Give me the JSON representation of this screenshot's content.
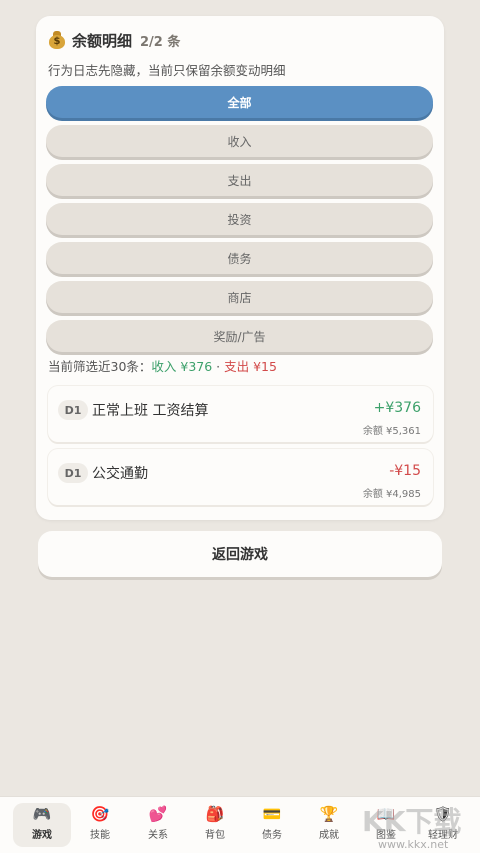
{
  "panel": {
    "icon": "money-bag-icon",
    "title": "余额明细",
    "count": "2/2 条",
    "subtitle": "行为日志先隐藏，当前只保留余额变动明细"
  },
  "filters": [
    {
      "label": "全部",
      "active": true
    },
    {
      "label": "收入",
      "active": false
    },
    {
      "label": "支出",
      "active": false
    },
    {
      "label": "投资",
      "active": false
    },
    {
      "label": "债务",
      "active": false
    },
    {
      "label": "商店",
      "active": false
    },
    {
      "label": "奖励/广告",
      "active": false
    }
  ],
  "summary": {
    "prefix": "当前筛选近30条：",
    "income": "收入 ¥376",
    "separator": " · ",
    "expense": "支出 ¥15"
  },
  "entries": [
    {
      "day": "D1",
      "title": "正常上班 工资结算",
      "amount": "+¥376",
      "balance": "余额 ¥5,361",
      "type": "pos"
    },
    {
      "day": "D1",
      "title": "公交通勤",
      "amount": "-¥15",
      "balance": "余额 ¥4,985",
      "type": "neg"
    }
  ],
  "return_label": "返回游戏",
  "tabs": [
    {
      "icon": "gamepad-icon",
      "glyph": "🎮",
      "label": "游戏",
      "active": true
    },
    {
      "icon": "target-icon",
      "glyph": "🎯",
      "label": "技能",
      "active": false
    },
    {
      "icon": "hearts-icon",
      "glyph": "💕",
      "label": "关系",
      "active": false
    },
    {
      "icon": "backpack-icon",
      "glyph": "🎒",
      "label": "背包",
      "active": false
    },
    {
      "icon": "card-icon",
      "glyph": "💳",
      "label": "债务",
      "active": false
    },
    {
      "icon": "trophy-icon",
      "glyph": "🏆",
      "label": "成就",
      "active": false
    },
    {
      "icon": "book-icon",
      "glyph": "📖",
      "label": "图鉴",
      "active": false
    },
    {
      "icon": "shield-icon",
      "glyph": "🛡",
      "label": "轻理财",
      "active": false
    }
  ],
  "watermark": {
    "text": "KK下载",
    "url": "www.kkx.net"
  },
  "colors": {
    "accent": "#5b90c3",
    "income": "#3ca06a",
    "expense": "#d24a4a"
  }
}
